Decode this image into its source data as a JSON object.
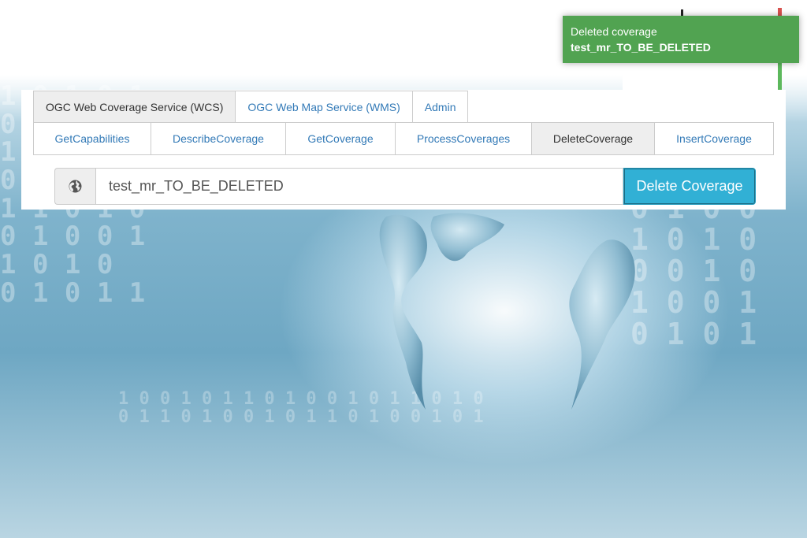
{
  "toast": {
    "title": "Deleted coverage",
    "message": "test_mr_TO_BE_DELETED",
    "color": "#51a351"
  },
  "service_tabs": [
    {
      "label": "OGC Web Coverage Service (WCS)",
      "active": true
    },
    {
      "label": "OGC Web Map Service (WMS)",
      "active": false
    },
    {
      "label": "Admin",
      "active": false
    }
  ],
  "operation_tabs": [
    {
      "label": "GetCapabilities",
      "active": false
    },
    {
      "label": "DescribeCoverage",
      "active": false
    },
    {
      "label": "GetCoverage",
      "active": false
    },
    {
      "label": "ProcessCoverages",
      "active": false
    },
    {
      "label": "DeleteCoverage",
      "active": true
    },
    {
      "label": "InsertCoverage",
      "active": false
    }
  ],
  "delete_form": {
    "addon_icon": "globe-icon",
    "coverage_id_value": "test_mr_TO_BE_DELETED",
    "button_label": "Delete Coverage",
    "button_color": "#31b0d5"
  },
  "colors": {
    "link": "#337ab7",
    "active_tab_bg": "#eeeeee"
  }
}
